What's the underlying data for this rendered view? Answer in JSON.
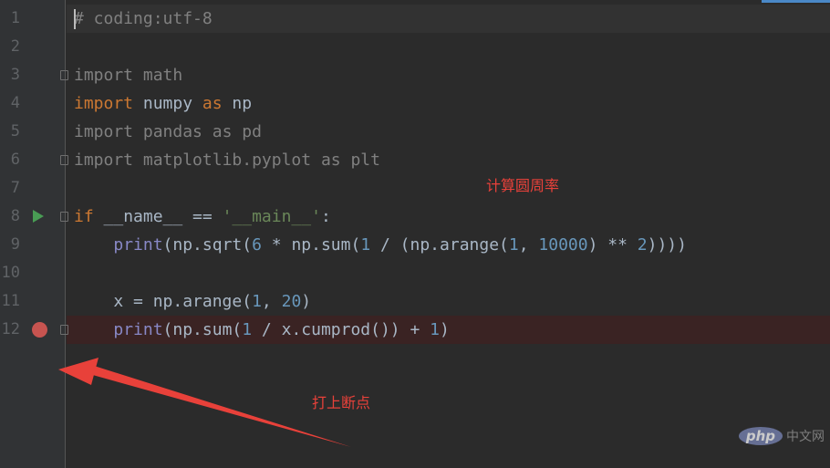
{
  "editor": {
    "lines": [
      {
        "num": "1",
        "tokens": [
          {
            "t": "# coding:utf-8",
            "c": "comment"
          }
        ]
      },
      {
        "num": "2",
        "tokens": []
      },
      {
        "num": "3",
        "tokens": [
          {
            "t": "import",
            "c": "kw-dim"
          },
          {
            "t": " math",
            "c": "unused"
          }
        ]
      },
      {
        "num": "4",
        "tokens": [
          {
            "t": "import",
            "c": "kw"
          },
          {
            "t": " numpy ",
            "c": "plain"
          },
          {
            "t": "as",
            "c": "kw"
          },
          {
            "t": " np",
            "c": "plain"
          }
        ]
      },
      {
        "num": "5",
        "tokens": [
          {
            "t": "import",
            "c": "kw-dim"
          },
          {
            "t": " pandas ",
            "c": "unused"
          },
          {
            "t": "as",
            "c": "kw-dim"
          },
          {
            "t": " pd",
            "c": "unused"
          }
        ]
      },
      {
        "num": "6",
        "tokens": [
          {
            "t": "import",
            "c": "kw-dim"
          },
          {
            "t": " matplotlib.pyplot ",
            "c": "unused"
          },
          {
            "t": "as",
            "c": "kw-dim"
          },
          {
            "t": " plt",
            "c": "unused"
          }
        ]
      },
      {
        "num": "7",
        "tokens": []
      },
      {
        "num": "8",
        "tokens": [
          {
            "t": "if",
            "c": "kw"
          },
          {
            "t": " __name__ == ",
            "c": "plain"
          },
          {
            "t": "'__main__'",
            "c": "str"
          },
          {
            "t": ":",
            "c": "plain"
          }
        ]
      },
      {
        "num": "9",
        "tokens": [
          {
            "t": "    ",
            "c": "plain"
          },
          {
            "t": "print",
            "c": "builtin"
          },
          {
            "t": "(np.sqrt(",
            "c": "plain"
          },
          {
            "t": "6",
            "c": "num"
          },
          {
            "t": " * np.sum(",
            "c": "plain"
          },
          {
            "t": "1",
            "c": "num"
          },
          {
            "t": " / (np.arange(",
            "c": "plain"
          },
          {
            "t": "1",
            "c": "num"
          },
          {
            "t": ", ",
            "c": "plain"
          },
          {
            "t": "10000",
            "c": "num"
          },
          {
            "t": ") ** ",
            "c": "plain"
          },
          {
            "t": "2",
            "c": "num"
          },
          {
            "t": "))))",
            "c": "plain"
          }
        ]
      },
      {
        "num": "10",
        "tokens": []
      },
      {
        "num": "11",
        "tokens": [
          {
            "t": "    x = np.arange(",
            "c": "plain"
          },
          {
            "t": "1",
            "c": "num"
          },
          {
            "t": ", ",
            "c": "plain"
          },
          {
            "t": "20",
            "c": "num"
          },
          {
            "t": ")",
            "c": "plain"
          }
        ]
      },
      {
        "num": "12",
        "tokens": [
          {
            "t": "    ",
            "c": "plain"
          },
          {
            "t": "print",
            "c": "builtin"
          },
          {
            "t": "(np.sum(",
            "c": "plain"
          },
          {
            "t": "1",
            "c": "num"
          },
          {
            "t": " / x.cumprod()) + ",
            "c": "plain"
          },
          {
            "t": "1",
            "c": "num"
          },
          {
            "t": ")",
            "c": "plain"
          }
        ]
      }
    ]
  },
  "annotations": {
    "compute_pi": "计算圆周率",
    "set_breakpoint": "打上断点"
  },
  "watermark": {
    "logo": "php",
    "site": "中文网"
  },
  "colors": {
    "background": "#2b2b2b",
    "gutter": "#313335",
    "keyword": "#cc7832",
    "number": "#6897bb",
    "string": "#6a8759",
    "builtin": "#8888c6",
    "breakpoint": "#c75450",
    "run": "#499c54",
    "annotation": "#e8413a"
  },
  "icons": {
    "run": "run-triangle-icon",
    "breakpoint": "breakpoint-dot-icon",
    "fold": "fold-marker-icon"
  }
}
